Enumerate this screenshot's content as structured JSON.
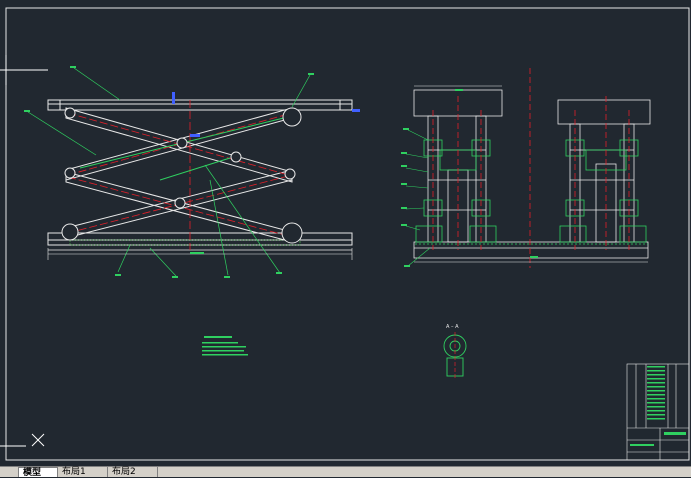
{
  "section_label": "A – A",
  "tabs": [
    {
      "label": "模型",
      "active": true
    },
    {
      "label": "布局1",
      "active": false
    },
    {
      "label": "布局2",
      "active": false
    }
  ],
  "colors": {
    "background": "#212830",
    "lines": "#e8e8e8",
    "structure": "#c8d8c8",
    "green": "#2fd060",
    "red": "#e0202a",
    "blue": "#4060ff",
    "hatch": "#50c850",
    "cursor": "#ffffff"
  }
}
